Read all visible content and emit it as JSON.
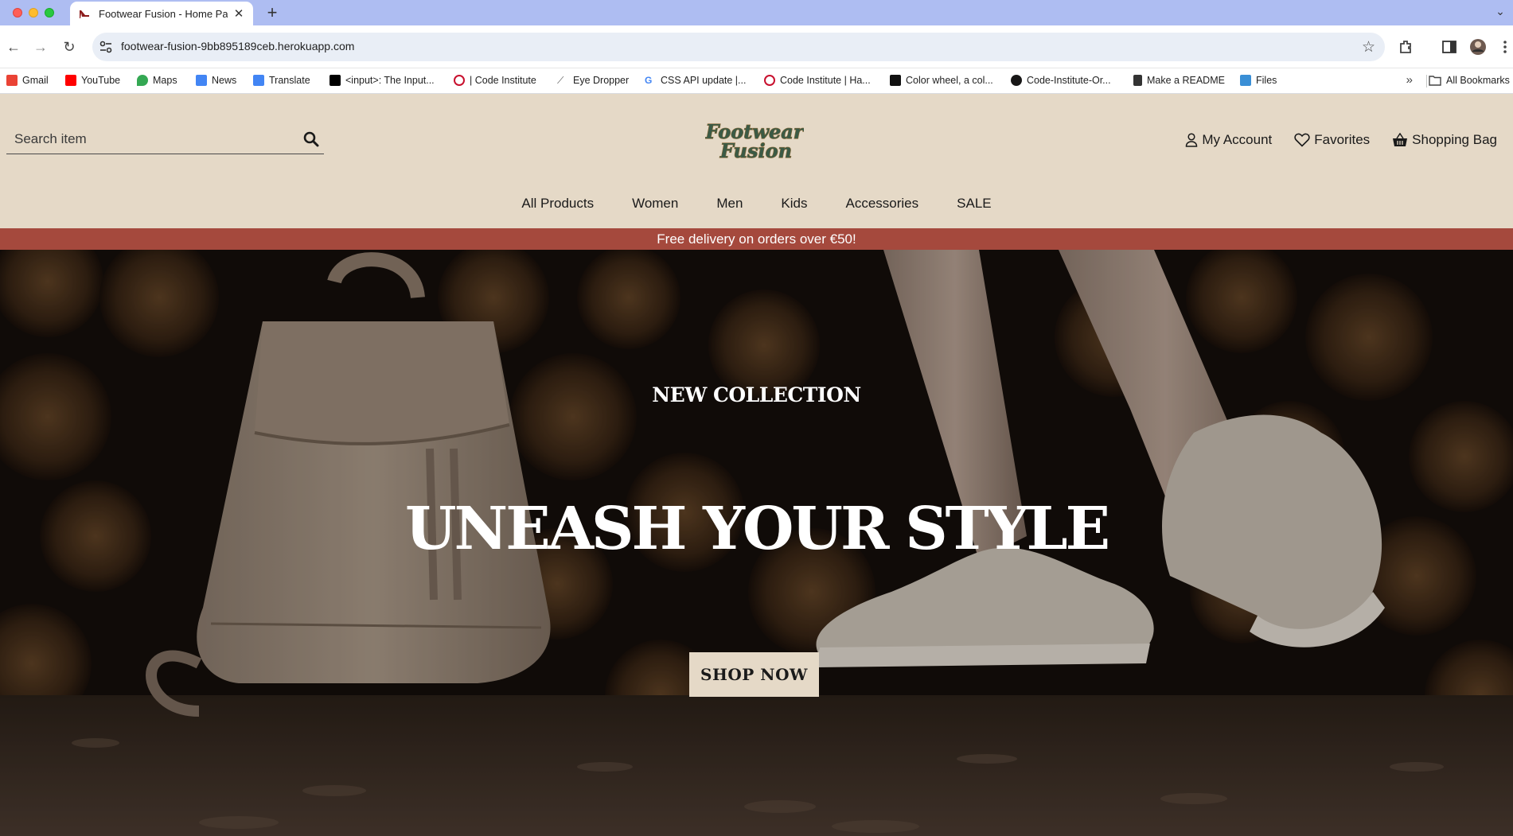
{
  "browser": {
    "tab_title": "Footwear Fusion - Home Page",
    "url": "footwear-fusion-9bb895189ceb.herokuapp.com",
    "bookmarks": [
      {
        "label": "Gmail",
        "icon": "gmail-icon",
        "color": "#ea4335"
      },
      {
        "label": "YouTube",
        "icon": "youtube-icon",
        "color": "#ff0000"
      },
      {
        "label": "Maps",
        "icon": "maps-icon",
        "color": "#34a853"
      },
      {
        "label": "News",
        "icon": "news-icon",
        "color": "#4285f4"
      },
      {
        "label": "Translate",
        "icon": "translate-icon",
        "color": "#4285f4"
      },
      {
        "label": "<input>: The Input...",
        "icon": "mdn-icon",
        "color": "#000000"
      },
      {
        "label": "| Code Institute",
        "icon": "code-institute-icon",
        "color": "#c8102e"
      },
      {
        "label": "Eye Dropper",
        "icon": "eyedropper-icon",
        "color": "#555555"
      },
      {
        "label": "CSS API update  |...",
        "icon": "google-icon",
        "color": "#4285f4"
      },
      {
        "label": "Code Institute | Ha...",
        "icon": "code-institute-icon",
        "color": "#c8102e"
      },
      {
        "label": "Color wheel, a col...",
        "icon": "adobe-color-icon",
        "color": "#111111"
      },
      {
        "label": "Code-Institute-Or...",
        "icon": "github-icon",
        "color": "#181717"
      },
      {
        "label": "Make a README",
        "icon": "document-icon",
        "color": "#333333"
      },
      {
        "label": "Files",
        "icon": "files-icon",
        "color": "#3a8fd6"
      }
    ],
    "all_bookmarks": "All Bookmarks"
  },
  "header": {
    "search_placeholder": "Search item",
    "logo_line1": "Footwear",
    "logo_line2": "Fusion",
    "account": "My Account",
    "favorites": "Favorites",
    "bag": "Shopping Bag"
  },
  "nav": {
    "items": [
      "All Products",
      "Women",
      "Men",
      "Kids",
      "Accessories",
      "SALE"
    ]
  },
  "banner": {
    "text": "Free delivery on orders over €50!"
  },
  "hero": {
    "kicker": "NEW COLLECTION",
    "title": "UNEASH YOUR STYLE",
    "cta": "SHOP NOW"
  },
  "colors": {
    "header_bg": "#e5d9c7",
    "banner_bg": "#a5493d",
    "cta_bg": "#e5d9c7"
  }
}
